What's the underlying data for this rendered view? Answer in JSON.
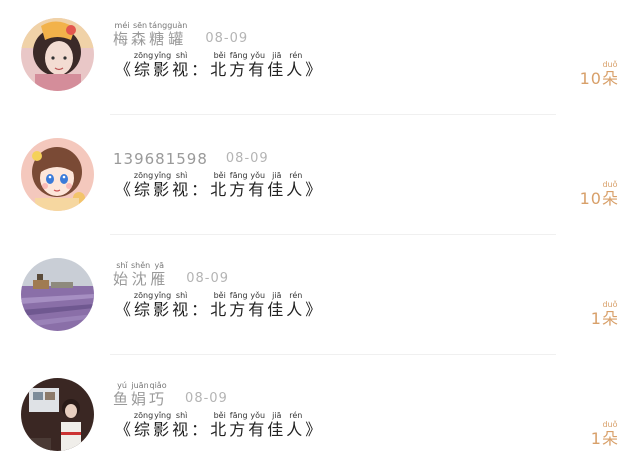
{
  "colors": {
    "name": "#9a9a9a",
    "date": "#b4b4b4",
    "comment": "#222222",
    "gift": "#d8a06a",
    "divider": "#f0f0f0"
  },
  "rows": [
    {
      "avatar_icon": "girl-with-bow-avatar",
      "name": [
        {
          "ch": "梅",
          "py": "méi"
        },
        {
          "ch": "森",
          "py": "sēn"
        },
        {
          "ch": "糖",
          "py": "táng"
        },
        {
          "ch": "罐",
          "py": "guàn"
        }
      ],
      "date": "08-09",
      "gift_count": "10",
      "gift_unit": {
        "ch": "朵",
        "py": "duǒ"
      }
    },
    {
      "avatar_icon": "cartoon-girl-avatar",
      "name_plain": "139681598",
      "date": "08-09",
      "gift_count": "10",
      "gift_unit": {
        "ch": "朵",
        "py": "duǒ"
      }
    },
    {
      "avatar_icon": "lavender-field-avatar",
      "name": [
        {
          "ch": "始",
          "py": "shǐ"
        },
        {
          "ch": "沈",
          "py": "shěn"
        },
        {
          "ch": "雁",
          "py": "yā"
        }
      ],
      "date": "08-09",
      "gift_count": "1",
      "gift_unit": {
        "ch": "朵",
        "py": "duǒ"
      }
    },
    {
      "avatar_icon": "girl-photo-avatar",
      "name": [
        {
          "ch": "鱼",
          "py": "yú"
        },
        {
          "ch": "娟",
          "py": "juān"
        },
        {
          "ch": "巧",
          "py": "qiǎo"
        }
      ],
      "date": "08-09",
      "gift_count": "1",
      "gift_unit": {
        "ch": "朵",
        "py": "duǒ"
      }
    }
  ],
  "comment": {
    "open": "《",
    "close": "》",
    "chars": [
      {
        "ch": "综",
        "py": "zōng"
      },
      {
        "ch": "影",
        "py": "yǐng"
      },
      {
        "ch": "视",
        "py": "shì"
      },
      {
        "ch": "：",
        "py": ""
      },
      {
        "ch": "北",
        "py": "běi"
      },
      {
        "ch": "方",
        "py": "fāng"
      },
      {
        "ch": "有",
        "py": "yǒu"
      },
      {
        "ch": "佳",
        "py": "jiā"
      },
      {
        "ch": "人",
        "py": "rén"
      }
    ]
  }
}
